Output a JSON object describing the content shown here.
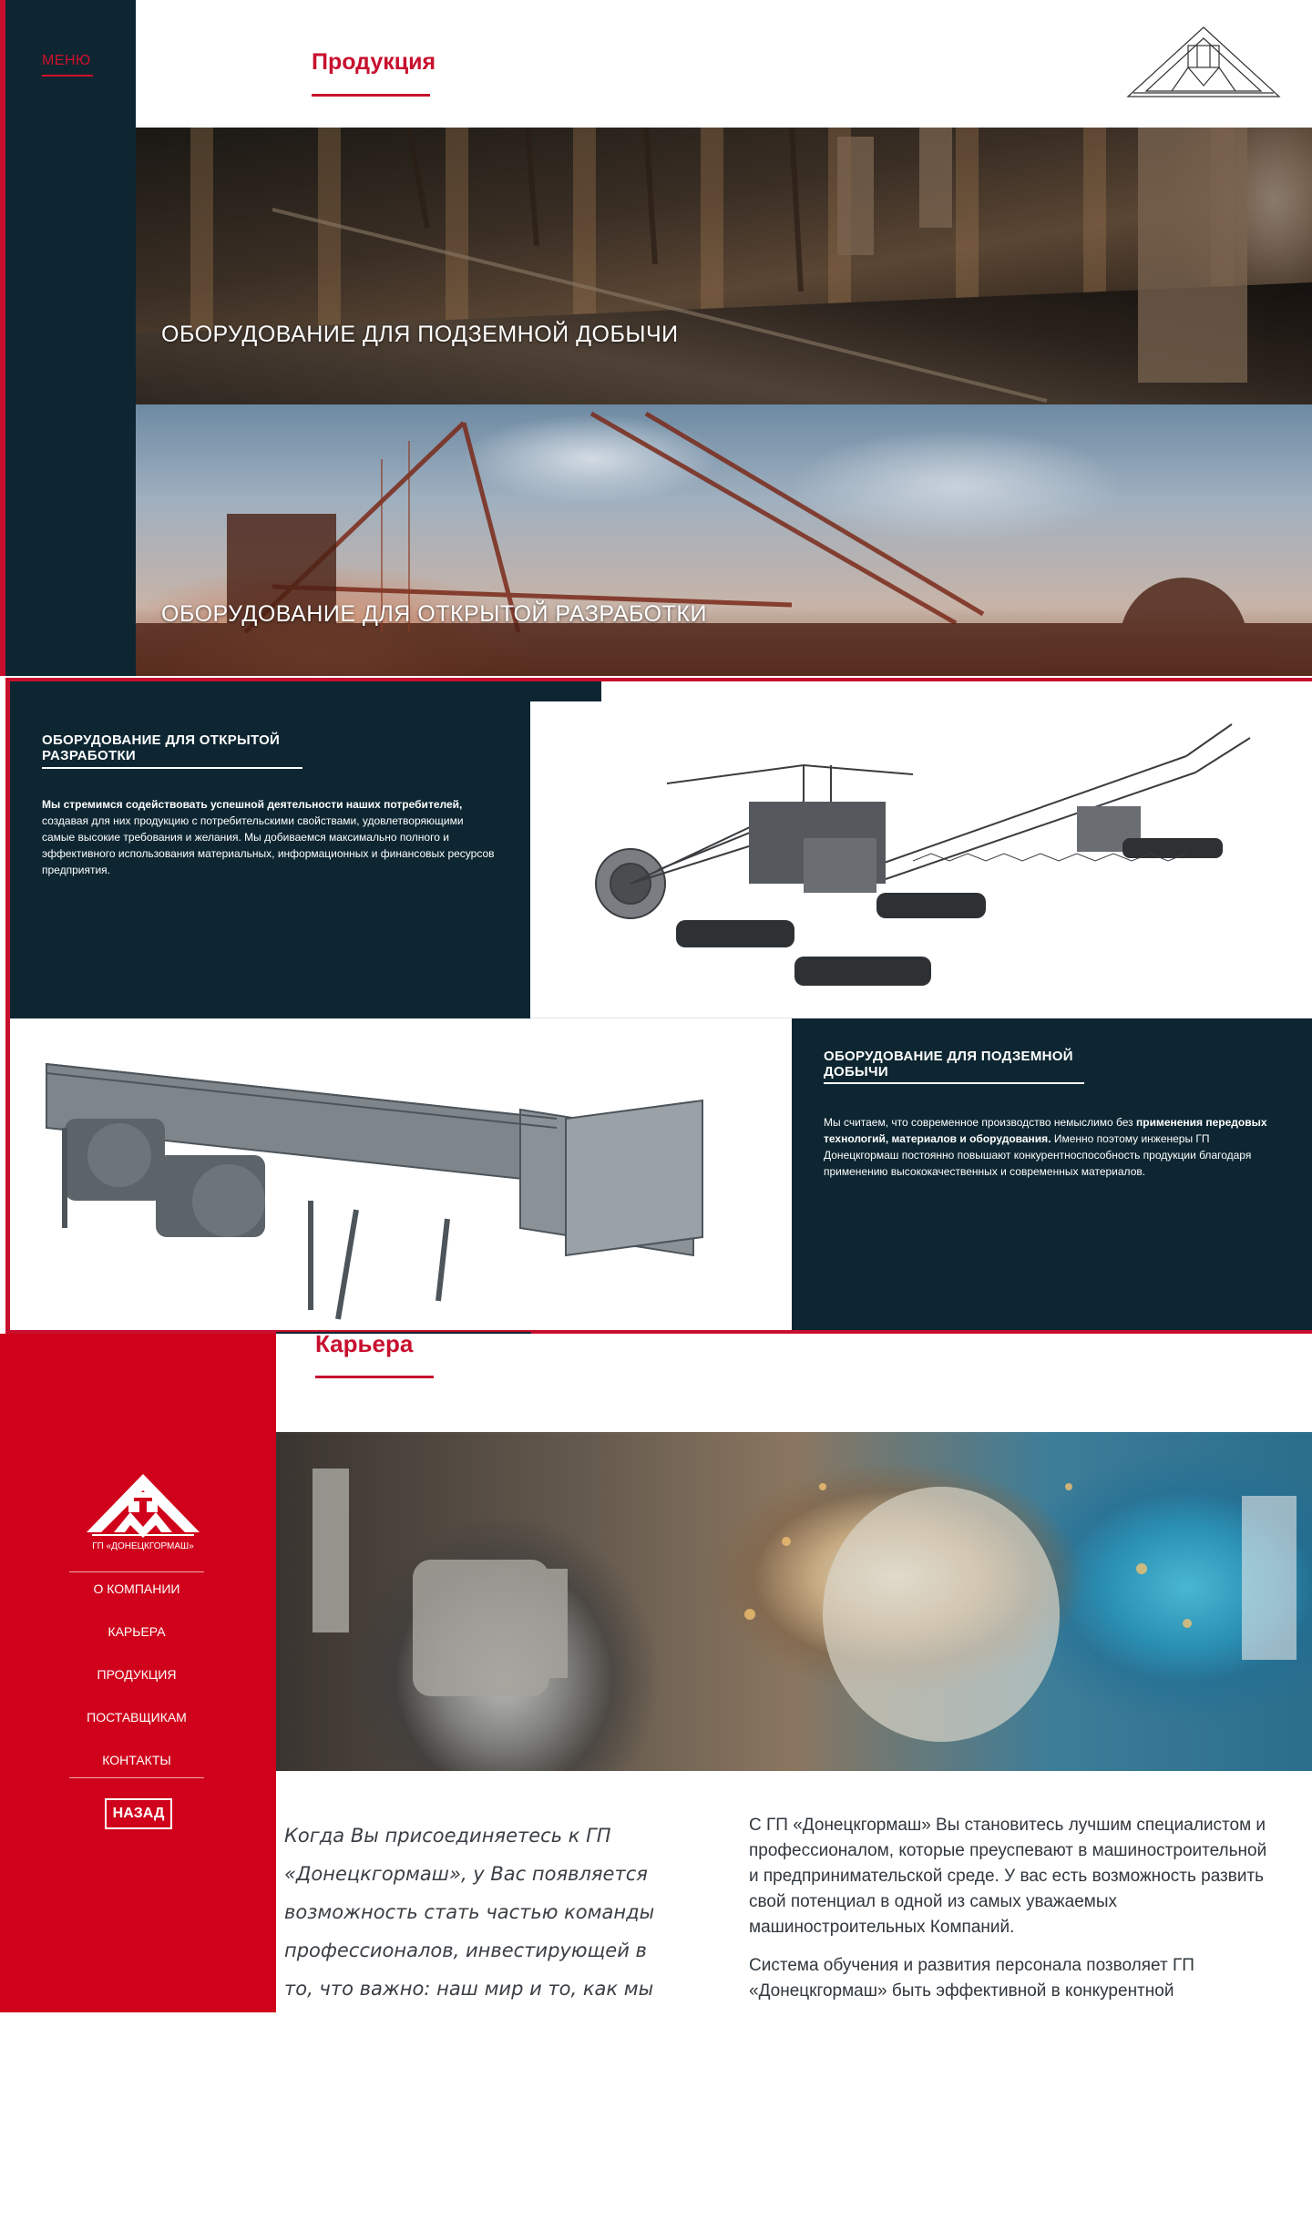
{
  "header": {
    "menu_label": "МЕНЮ",
    "section_title": "Продукция"
  },
  "banners": [
    {
      "title": "ОБОРУДОВАНИЕ ДЛЯ ПОДЗЕМНОЙ ДОБЫЧИ"
    },
    {
      "title": "ОБОРУДОВАНИЕ ДЛЯ ОТКРЫТОЙ РАЗРАБОТКИ"
    }
  ],
  "open_pit_block": {
    "title_line1": "ОБОРУДОВАНИЕ ДЛЯ ОТКРЫТОЙ",
    "title_line2": "РАЗРАБОТКИ",
    "text_bold": "Мы стремимся содействовать успешной деятельности наших потребителей,",
    "text_rest": "создавая для них продукцию с потребительскими свойствами, удовлетворяющими самые высокие требования и желания. Мы добиваемся максимально полного и эффективного использования материальных, информационных и финансовых ресурсов предприятия."
  },
  "underground_block": {
    "title_line1": "ОБОРУДОВАНИЕ ДЛЯ ПОДЗЕМНОЙ",
    "title_line2": "ДОБЫЧИ",
    "text_start": "Мы считаем, что современное производство немыслимо без ",
    "text_bold": "применения передовых технологий, материалов и оборудования.",
    "text_rest": " Именно поэтому инженеры ГП Донецкгормаш постоянно повышают конкурентноспособность продукции благодаря применению высококачественных и современных материалов."
  },
  "career": {
    "section_title": "Карьера",
    "logo_caption": "ГП «ДОНЕЦКГОРМАШ»",
    "nav": [
      {
        "label": "О КОМПАНИИ"
      },
      {
        "label": "КАРЬЕРА"
      },
      {
        "label": "ПРОДУКЦИЯ"
      },
      {
        "label": "ПОСТАВЩИКАМ"
      },
      {
        "label": "КОНТАКТЫ"
      }
    ],
    "back_label": "НАЗАД",
    "quote": "Когда Вы присоединяетесь к ГП «Донецкгормаш», у Вас появляется возможность стать частью команды профессионалов, инвестирующей в то, что важно: наш мир и то, как мы",
    "paragraph1": "С ГП «Донецкгормаш» Вы становитесь лучшим специалистом и профессионалом, которые преуспевают в машиностроительной и предпринимательской среде. У вас есть возможность развить свой потенциал в одной из самых уважаемых машиностроительных Компаний.",
    "paragraph2": "Система обучения и развития персонала позволяет ГП «Донецкгормаш» быть эффективной в конкурентной"
  },
  "colors": {
    "brand_red": "#c8102e",
    "dark_navy": "#0d2631",
    "sidebar_red": "#d0021b"
  },
  "icons": {
    "logo": "donetskgormash-logo",
    "excavator": "bucket-wheel-excavator-image",
    "conveyor": "conveyor-drive-image"
  }
}
